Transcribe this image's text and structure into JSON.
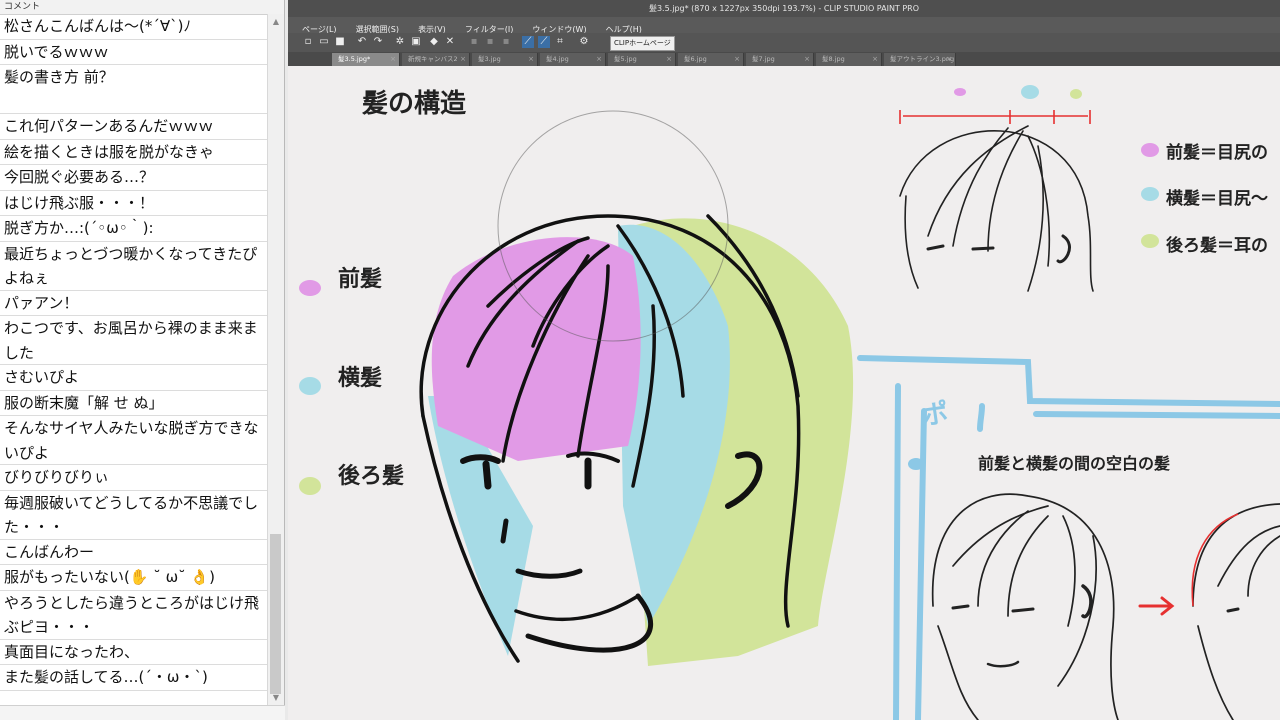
{
  "comment_panel": {
    "header": "コメント",
    "comments": [
      "松さんこんばんは～(*´∀`)ﾉ",
      "脱いでるｗｗｗ",
      "髪の書き方 前？",
      "これ何パターンあるんだｗｗｗ",
      "絵を描くときは服を脱がなきゃ",
      "今回脱ぐ必要ある…？",
      "はじけ飛ぶ服・・・！",
      "脱ぎ方か…:(´◦ω◦｀):",
      "最近ちょっとづつ暖かくなってきたぴよねぇ",
      "パァアン！",
      "わこつです、お風呂から裸のまま来ました",
      "さむいぴよ",
      "服の断末魔「解 せ ぬ」",
      "そんなサイヤ人みたいな脱ぎ方できないぴよ",
      "びりびりびりぃ",
      "毎週服破いてどうしてるか不思議でした・・・",
      "こんばんわー",
      "服がもったいない(✋ ˘ ω˘ 👌)",
      "やろうとしたら違うところがはじけ飛ぶピヨ・・・",
      "真面目になったわ、",
      "また髪の話してる…(´・ω・`)"
    ]
  },
  "app": {
    "window_title": "髪3.5.jpg* (870 x 1227px 350dpi 193.7%) - CLIP STUDIO PAINT PRO",
    "menu": [
      "ページ(L)",
      "選択範囲(S)",
      "表示(V)",
      "フィルター(I)",
      "ウィンドウ(W)",
      "ヘルプ(H)"
    ],
    "home_button": "CLIPホームページ",
    "tabs": [
      {
        "label": "髪3.5.jpg*",
        "active": true
      },
      {
        "label": "新規キャンバス2",
        "active": false
      },
      {
        "label": "髪3.jpg",
        "active": false
      },
      {
        "label": "髪4.jpg",
        "active": false
      },
      {
        "label": "髪5.jpg",
        "active": false
      },
      {
        "label": "髪6.jpg",
        "active": false
      },
      {
        "label": "髪7.jpg",
        "active": false
      },
      {
        "label": "髪8.jpg",
        "active": false
      },
      {
        "label": "髪アウトライン3.png",
        "active": false
      }
    ]
  },
  "illustration": {
    "title": "髪の構造",
    "legend_left": [
      "前髪",
      "横髪",
      "後ろ髪"
    ],
    "legend_right": [
      "前髪＝目尻の",
      "横髪＝目尻～",
      "後ろ髪＝耳の"
    ],
    "gap_caption": "前髪と横髪の間の空白の髪",
    "po_text": "ポ",
    "colors": {
      "front": "#e19ae6",
      "side": "#a6dbe6",
      "back": "#d2e49a",
      "arrow_red": "#e63030",
      "sketch_blue": "#8cc8e6"
    }
  }
}
